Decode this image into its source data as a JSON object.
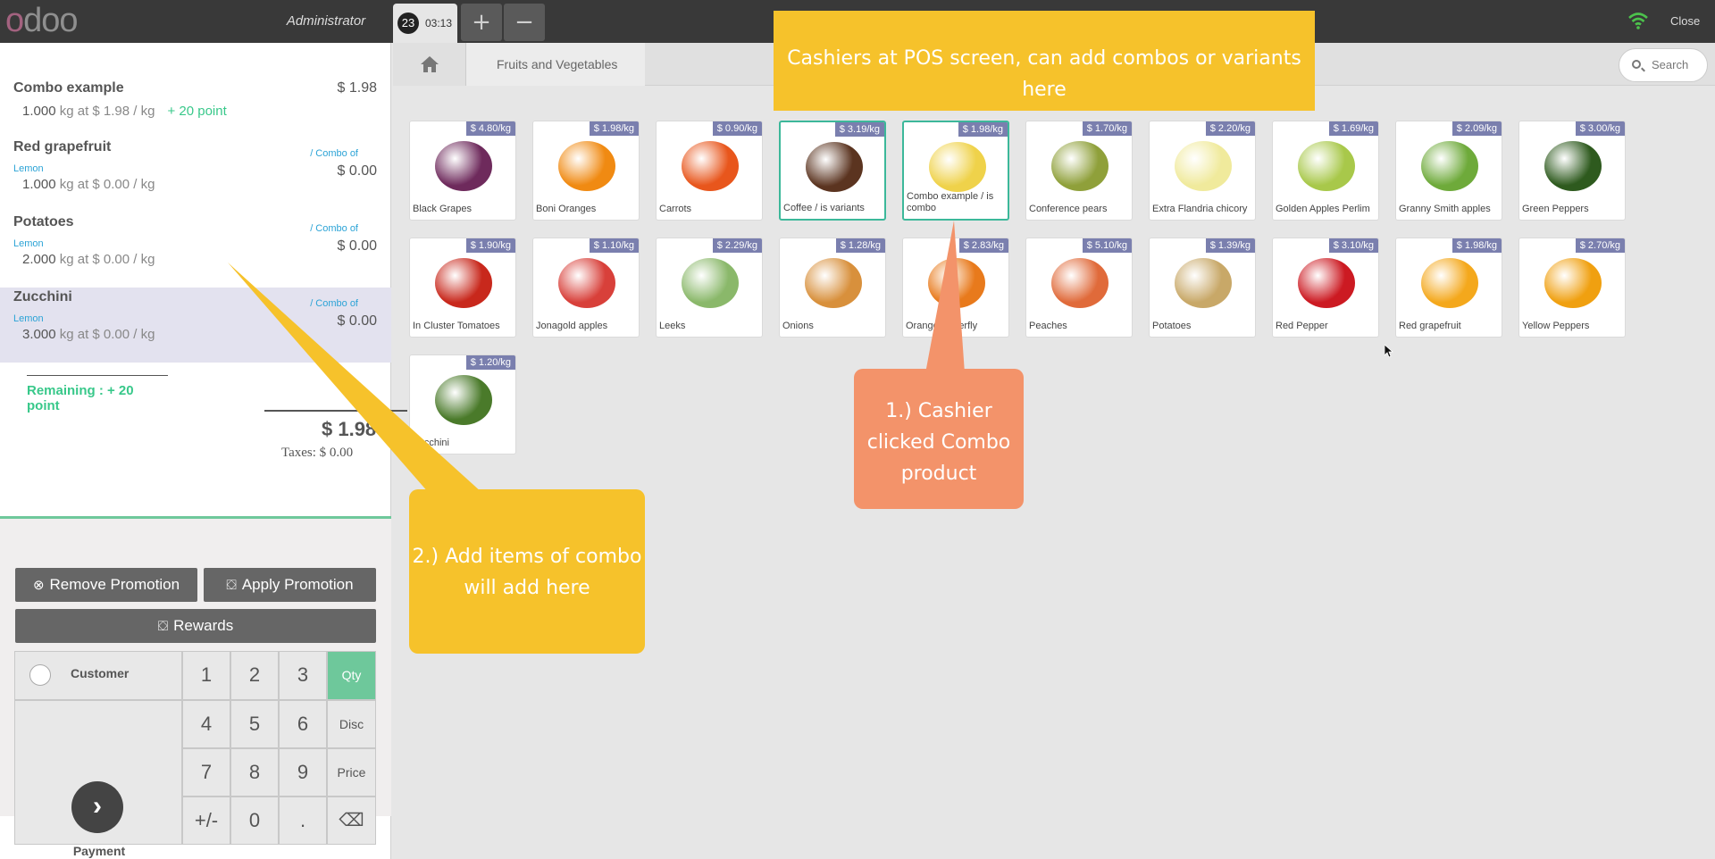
{
  "topbar": {
    "logo": "odoo",
    "user": "Administrator",
    "order_number": "23",
    "order_time": "03:13",
    "add_label": "+",
    "remove_label": "−",
    "close_label": "Close"
  },
  "orderlines": [
    {
      "name": "Combo example",
      "price": "$ 1.98",
      "qty_value": "1.000",
      "qty_unit": "kg at $ 1.98 / kg",
      "points": "+ 20 point"
    },
    {
      "name": "Red grapefruit",
      "combo": "/ Combo of",
      "sub": "Lemon",
      "price": "$ 0.00",
      "qty_value": "1.000",
      "qty_unit": "kg at $ 0.00 / kg"
    },
    {
      "name": "Potatoes",
      "combo": "/ Combo of",
      "sub": "Lemon",
      "price": "$ 0.00",
      "qty_value": "2.000",
      "qty_unit": "kg at $ 0.00 / kg"
    },
    {
      "name": "Zucchini",
      "combo": "/ Combo of",
      "sub": "Lemon",
      "price": "$ 0.00",
      "qty_value": "3.000",
      "qty_unit": "kg at $ 0.00 / kg"
    }
  ],
  "summary": {
    "remaining": "Remaining : + 20 point",
    "total": "$ 1.98",
    "taxes": "Taxes: $ 0.00"
  },
  "actions": {
    "remove_promotion": "Remove Promotion",
    "apply_promotion": "Apply Promotion",
    "rewards": "Rewards"
  },
  "numpad": {
    "customer": "Customer",
    "payment": "Payment",
    "keys": [
      "1",
      "2",
      "3",
      "4",
      "5",
      "6",
      "7",
      "8",
      "9",
      "+/-",
      "0",
      "."
    ],
    "modes": [
      "Qty",
      "Disc",
      "Price"
    ],
    "backspace": "⌫",
    "active_mode": "Qty"
  },
  "breadcrumb": {
    "category": "Fruits and Vegetables"
  },
  "search": {
    "placeholder": "Search"
  },
  "products": [
    {
      "name": "Black Grapes",
      "price": "$ 4.80/kg",
      "color": "#6e2a5c"
    },
    {
      "name": "Boni Oranges",
      "price": "$ 1.98/kg",
      "color": "#f08a12"
    },
    {
      "name": "Carrots",
      "price": "$ 0.90/kg",
      "color": "#e8561c"
    },
    {
      "name": "Coffee / is variants",
      "price": "$ 3.19/kg",
      "color": "#5b3420"
    },
    {
      "name": "Combo example / is combo",
      "price": "$ 1.98/kg",
      "color": "#efd24a"
    },
    {
      "name": "Conference pears",
      "price": "$ 1.70/kg",
      "color": "#8fa03a"
    },
    {
      "name": "Extra Flandria chicory",
      "price": "$ 2.20/kg",
      "color": "#f0ea9c"
    },
    {
      "name": "Golden Apples Perlim",
      "price": "$ 1.69/kg",
      "color": "#a8c84a"
    },
    {
      "name": "Granny Smith apples",
      "price": "$ 2.09/kg",
      "color": "#6eaa3a"
    },
    {
      "name": "Green Peppers",
      "price": "$ 3.00/kg",
      "color": "#2e5a1e"
    },
    {
      "name": "In Cluster Tomatoes",
      "price": "$ 1.90/kg",
      "color": "#c8281c"
    },
    {
      "name": "Jonagold apples",
      "price": "$ 1.10/kg",
      "color": "#d8403a"
    },
    {
      "name": "Leeks",
      "price": "$ 2.29/kg",
      "color": "#8ab86a"
    },
    {
      "name": "Onions",
      "price": "$ 1.28/kg",
      "color": "#d8903c"
    },
    {
      "name": "Orange Butterfly",
      "price": "$ 2.83/kg",
      "color": "#e87a1c"
    },
    {
      "name": "Peaches",
      "price": "$ 5.10/kg",
      "color": "#e06a3a"
    },
    {
      "name": "Potatoes",
      "price": "$ 1.39/kg",
      "color": "#c8a868"
    },
    {
      "name": "Red Pepper",
      "price": "$ 3.10/kg",
      "color": "#cc1a22"
    },
    {
      "name": "Red grapefruit",
      "price": "$ 1.98/kg",
      "color": "#f4a81c"
    },
    {
      "name": "Yellow Peppers",
      "price": "$ 2.70/kg",
      "color": "#f0a010"
    },
    {
      "name": "Zucchini",
      "price": "$ 1.20/kg",
      "color": "#4a7a2a"
    }
  ],
  "annotations": {
    "top": "Cashiers at POS screen, can add combos or variants here",
    "step1": "1.) Cashier clicked Combo product",
    "step2": "2.) Add items of combo will add here"
  }
}
